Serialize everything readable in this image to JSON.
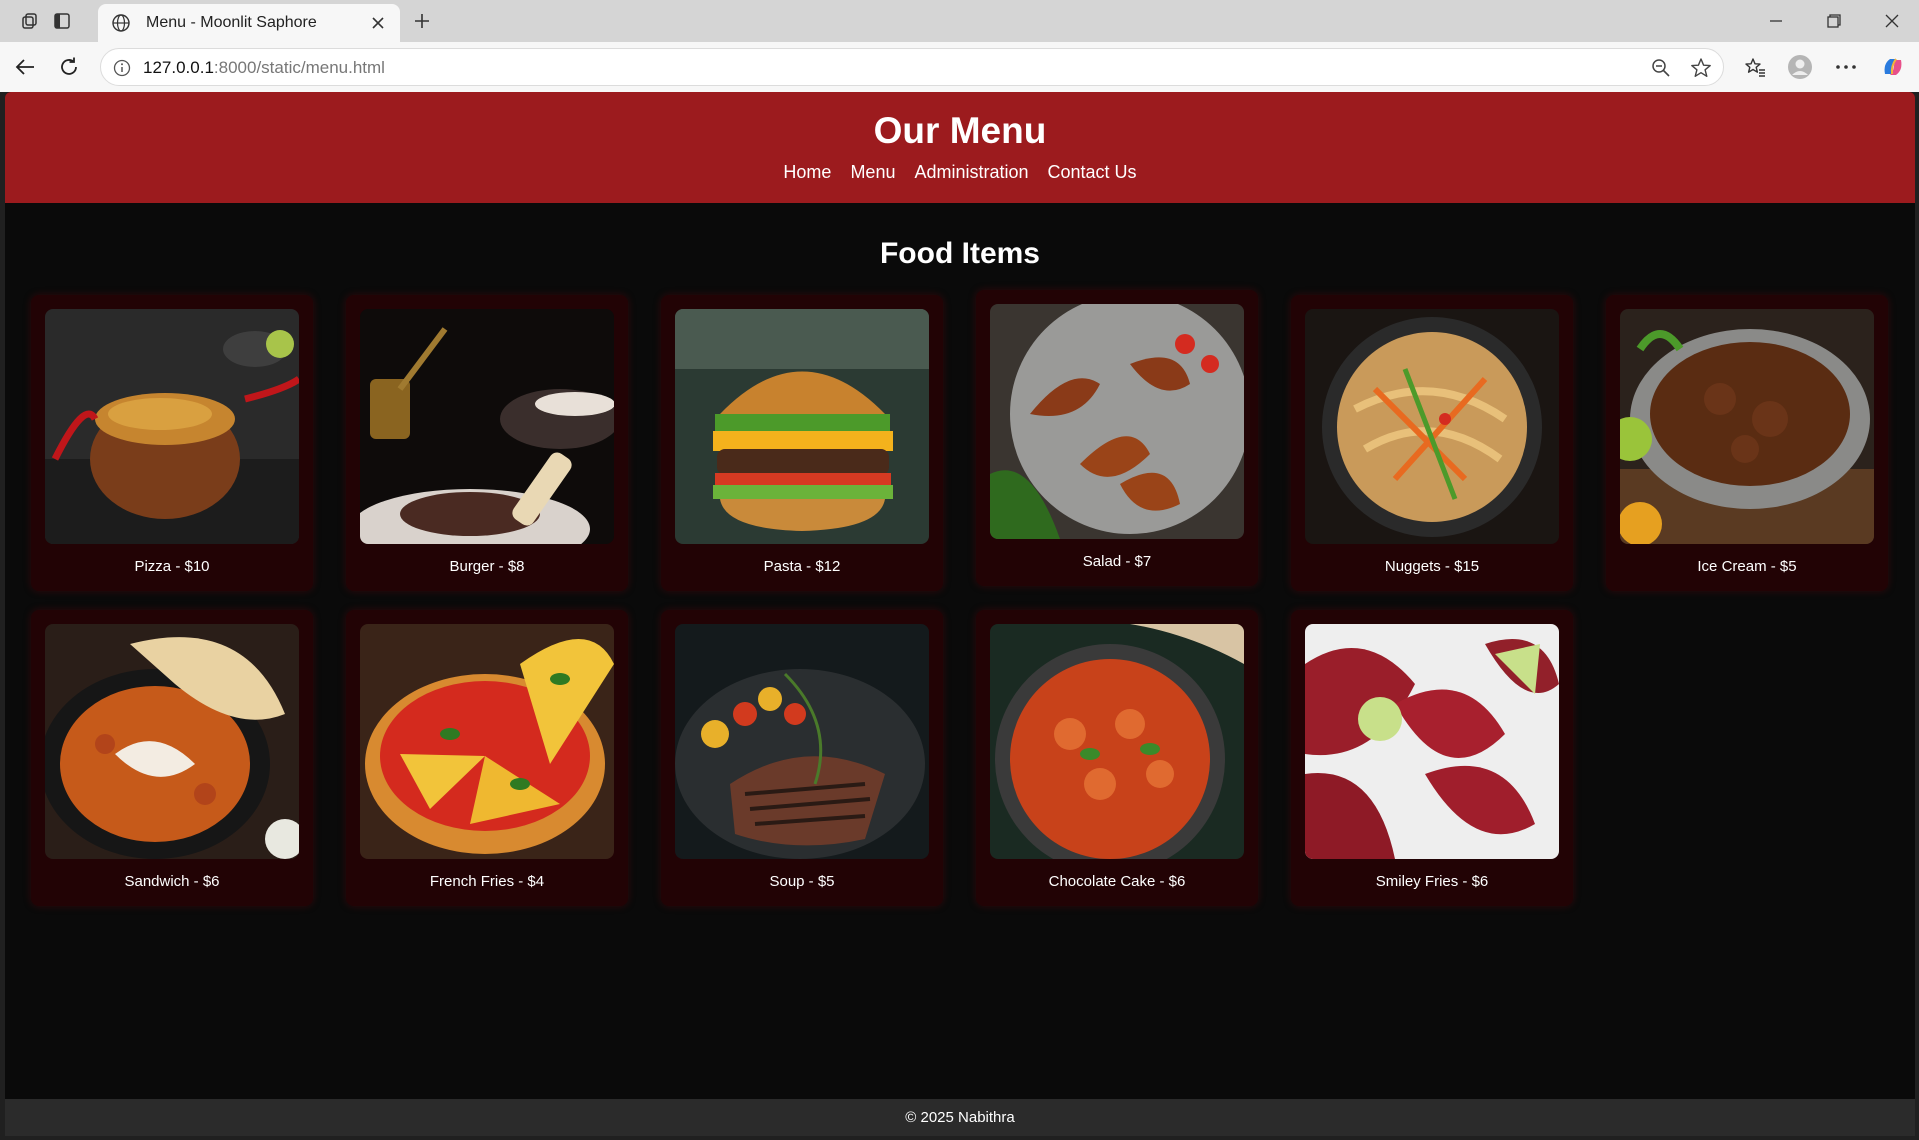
{
  "browser": {
    "tab_title": "Menu - Moonlit Saphore",
    "url_host": "127.0.0.1",
    "url_rest": ":8000/static/menu.html"
  },
  "header": {
    "title": "Our Menu",
    "nav": [
      "Home",
      "Menu",
      "Administration",
      "Contact Us"
    ]
  },
  "section_title": "Food Items",
  "items": [
    {
      "label": "Pizza - $10"
    },
    {
      "label": "Burger - $8"
    },
    {
      "label": "Pasta - $12"
    },
    {
      "label": "Salad - $7"
    },
    {
      "label": "Nuggets - $15"
    },
    {
      "label": "Ice Cream - $5"
    },
    {
      "label": "Sandwich - $6"
    },
    {
      "label": "French Fries - $4"
    },
    {
      "label": "Soup - $5"
    },
    {
      "label": "Chocolate Cake - $6"
    },
    {
      "label": "Smiley Fries - $6"
    }
  ],
  "footer": "© 2025 Nabithra",
  "colors": {
    "header_bg": "#9c1b1e",
    "page_bg": "#0a0a0a",
    "card_bg": "#220305",
    "footer_bg": "#2b2b2b"
  }
}
